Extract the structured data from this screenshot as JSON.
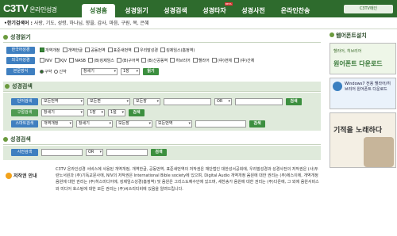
{
  "header": {
    "logo": "C3TV",
    "logo_sub": "온라인성경",
    "tabs": [
      "성경홈",
      "성경읽기",
      "성경검색",
      "성경타자",
      "성경사전",
      "온라인찬송"
    ],
    "beta": "BETA",
    "main_link": "C3TV메인"
  },
  "subnav": {
    "title": "•한기검색어 :",
    "items": "사랑, 기도, 성령, 하나님, 향을, 감사, 마음, 구원, 복, 은혜"
  },
  "read": {
    "title": "성경읽기",
    "label_kr": "한국어성경",
    "kr_versions": [
      "개역개정",
      "개역한글",
      "공동번역",
      "표준새번역",
      "우리말성경",
      "킹제임스(흠정역)"
    ],
    "label_en": "외국어성경",
    "en_versions": [
      "NIV",
      "KJV",
      "NASB",
      "(B)킹제임스",
      "(B)구어역",
      "(B)신공동역",
      "히브리어",
      "헬라어",
      "(中)번체",
      "(中)간체"
    ],
    "label_style": "본문방식",
    "style_opts": [
      "구약",
      "신약"
    ],
    "book": "창세기",
    "chapter": "1장",
    "go": "읽기"
  },
  "search": {
    "title": "성경검색",
    "label1": "단어검색",
    "a": "모든번역",
    "b": "모든편",
    "c": "모든장",
    "or": "OR",
    "btn": "검색",
    "label2": "구절검색",
    "book": "창세기",
    "ch": "1장",
    "vs": "1절",
    "label3": "스마트검색",
    "s_trans": "개역개정",
    "s_book": "창세기",
    "s_ch": "모든장",
    "s_all": "모든번역"
  },
  "dict": {
    "title": "성경검색",
    "label": "사전검색",
    "or": "OR",
    "btn": "검색"
  },
  "copyright": {
    "label": "저작권 안내",
    "text": "C3TV 온라인성경 서비스에 사용된 개역개정, 개역한글, 공동번역, 표준새번역의 저작권은 재단법인 대한성서공회에, 우리말성경과 성경사전의 저작권은 (사)두란노서원과 (주)기독교문사에, NIV의 저작권은 International Bible society에 있으며, Digital Audio 개역개정 음원에 대한 권리는 (주)에스이에, 개역개정 음원에 대한 권리는 (주)히스미디어에, 킹제임스성경(흠정역) 및 음원은 그리스도예수안에 있으며, 새찬송가 음원에 대한 권리는 (주)다온에, 그 외에 음원서비스와 미디어 호스팅에 대한 모든 권리는 (주)씨쓰리티비에 있음을 알려드립니다."
  },
  "side": {
    "font_title": "웹어폰트설치",
    "ad1": "원어폰트 다운로드",
    "ad2": "Windows7 전용 헬라어/히브리어 원어폰트 다운로드",
    "ad3": "기적을 노래하다"
  }
}
